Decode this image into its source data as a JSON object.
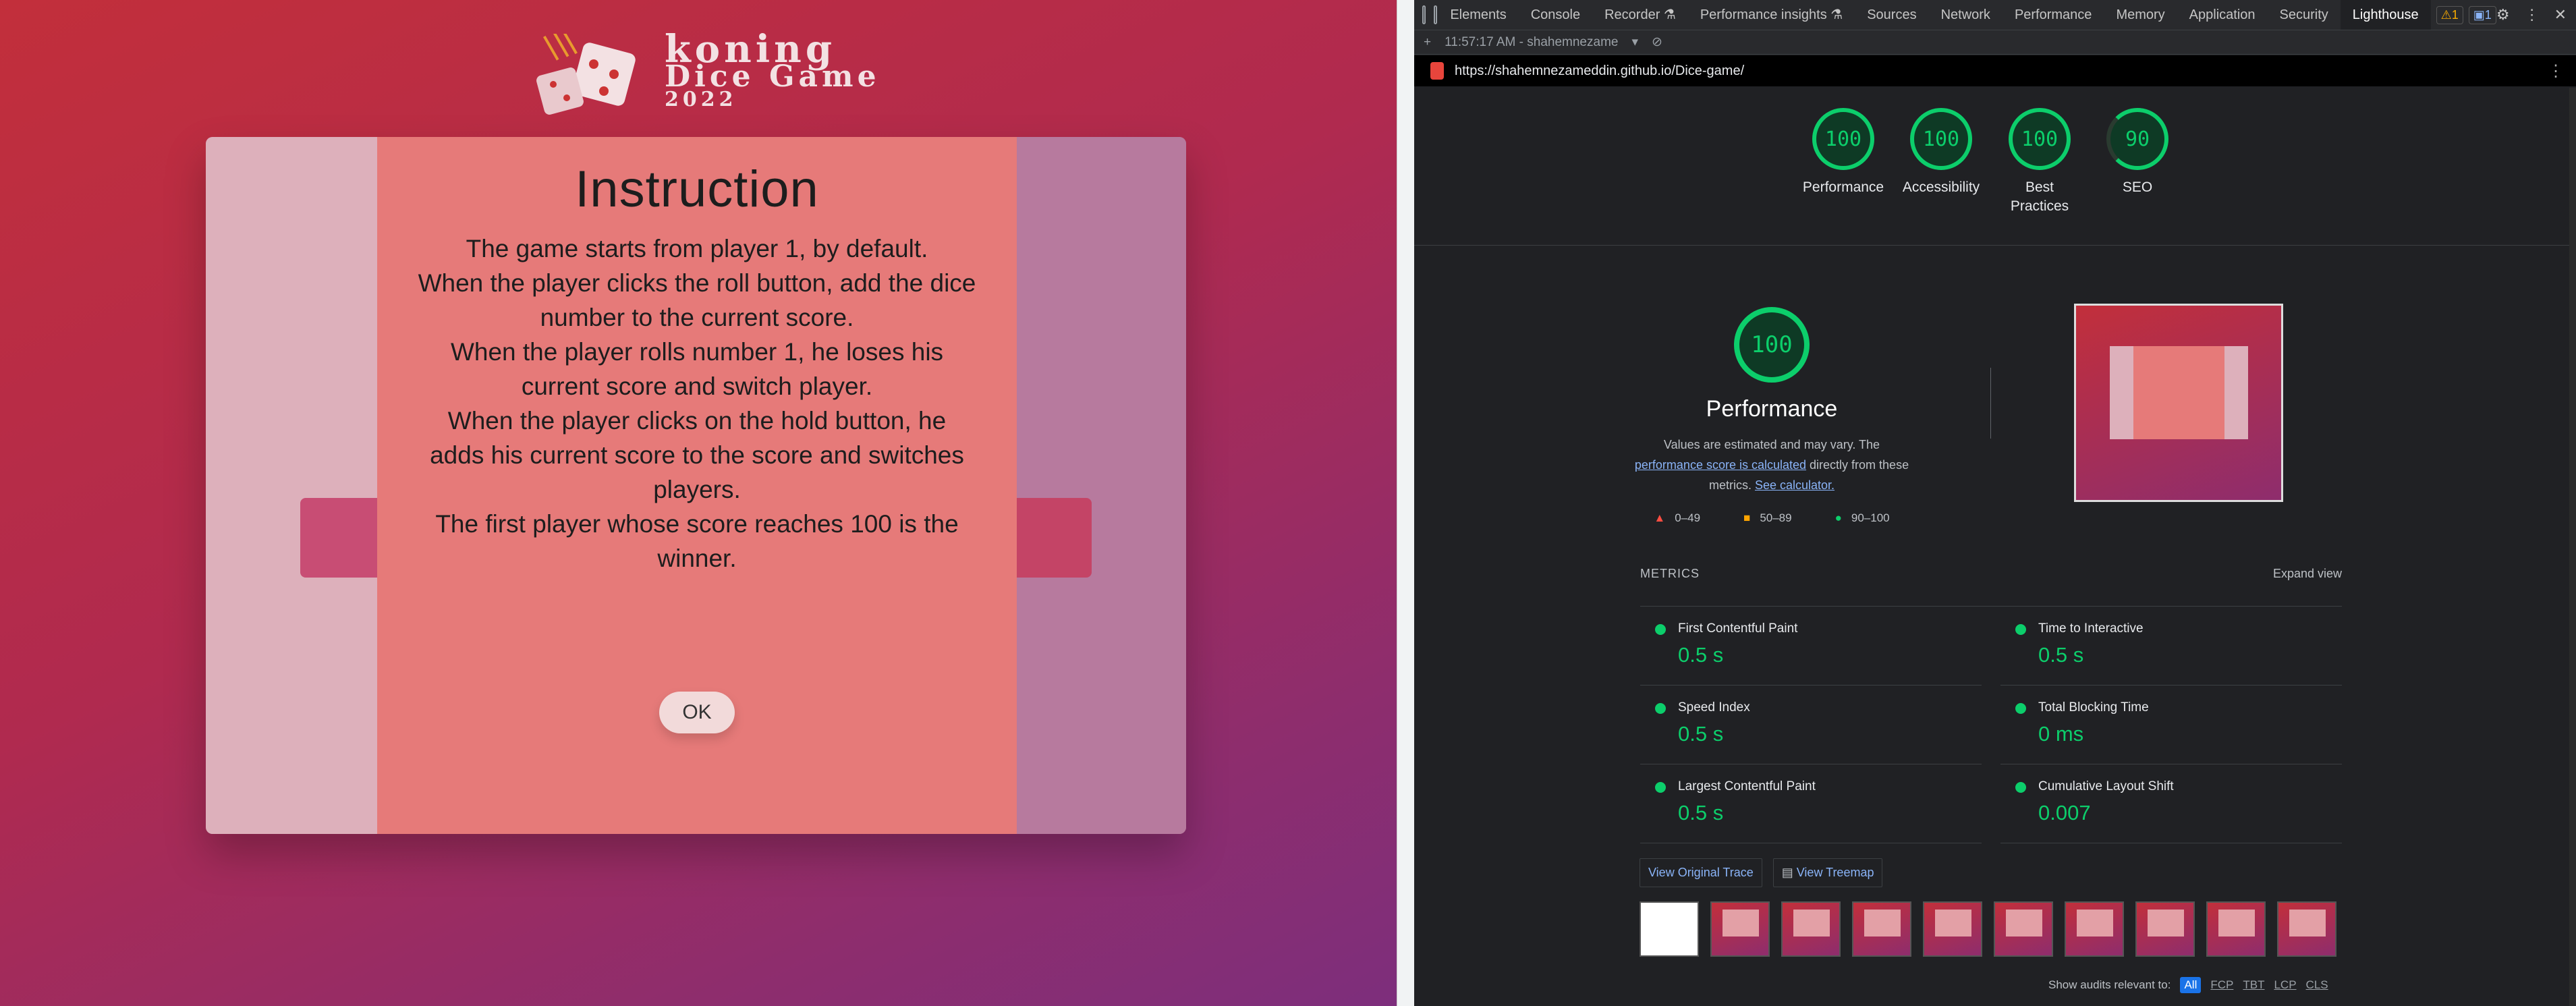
{
  "game": {
    "logo": {
      "line1": "koning",
      "line2": "Dice Game",
      "line3": "2022"
    },
    "modal": {
      "title": "Instruction",
      "rules": [
        "The game starts from player 1, by default.",
        "When the player clicks the roll button, add the dice number to the current score.",
        "When the player rolls number 1, he loses his current score and switch player.",
        "When the player clicks on the hold button, he adds his current score to the score and switches players.",
        "The first player whose score reaches 100 is the winner."
      ],
      "ok_label": "OK"
    }
  },
  "devtools": {
    "tabs": [
      "Elements",
      "Console",
      "Recorder ⚗",
      "Performance insights ⚗",
      "Sources",
      "Network",
      "Performance",
      "Memory",
      "Application",
      "Security",
      "Lighthouse"
    ],
    "active_tab": "Lighthouse",
    "warnings_badge": "⚠1",
    "messages_badge": "▣1",
    "report_time": "11:57:17 AM - shahemnezame",
    "url": "https://shahemnezameddin.github.io/Dice-game/",
    "scores": [
      {
        "label": "Performance",
        "value": "100"
      },
      {
        "label": "Accessibility",
        "value": "100"
      },
      {
        "label": "Best Practices",
        "value": "100"
      },
      {
        "label": "SEO",
        "value": "90"
      }
    ],
    "perf": {
      "score": "100",
      "title": "Performance",
      "desc_pre": "Values are estimated and may vary. The ",
      "desc_link": "performance score is calculated",
      "desc_mid": " directly from these metrics. ",
      "desc_link2": "See calculator.",
      "legend": [
        "0–49",
        "50–89",
        "90–100"
      ]
    },
    "metrics": {
      "header": "METRICS",
      "expand": "Expand view",
      "items": [
        {
          "name": "First Contentful Paint",
          "value": "0.5 s"
        },
        {
          "name": "Time to Interactive",
          "value": "0.5 s"
        },
        {
          "name": "Speed Index",
          "value": "0.5 s"
        },
        {
          "name": "Total Blocking Time",
          "value": "0 ms"
        },
        {
          "name": "Largest Contentful Paint",
          "value": "0.5 s"
        },
        {
          "name": "Cumulative Layout Shift",
          "value": "0.007"
        }
      ]
    },
    "buttons": {
      "trace": "View Original Trace",
      "treemap": "View Treemap"
    },
    "filter": {
      "label": "Show audits relevant to:",
      "options": [
        "All",
        "FCP",
        "TBT",
        "LCP",
        "CLS"
      ]
    },
    "colors": {
      "pass": "#0cce6b",
      "game_modal": "#e67a79"
    }
  }
}
